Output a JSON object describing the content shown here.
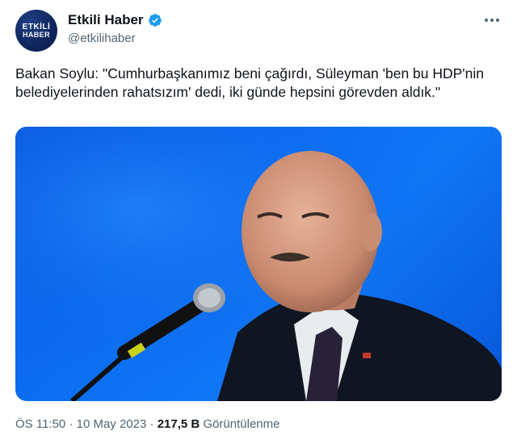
{
  "author": {
    "avatar_line1": "ETKİLİ",
    "avatar_line2": "HABER",
    "display_name": "Etkili Haber",
    "handle": "@etkilihaber"
  },
  "tweet": {
    "text": "Bakan Soylu: \"Cumhurbaşkanımız beni çağırdı, Süleyman 'ben bu HDP'nin belediyelerinden rahatsızım' dedi, iki günde hepsini görevden aldık.\""
  },
  "meta": {
    "time": "ÖS 11:50",
    "separator": "·",
    "date": "10 May 2023",
    "views_count": "217,5 B",
    "views_label": "Görüntülenme"
  },
  "colors": {
    "verified": "#1d9bf0",
    "media_background": "#0c6cf0",
    "secondary_text": "#536471"
  },
  "icons": [
    "verified-badge-icon",
    "more-options-icon"
  ]
}
